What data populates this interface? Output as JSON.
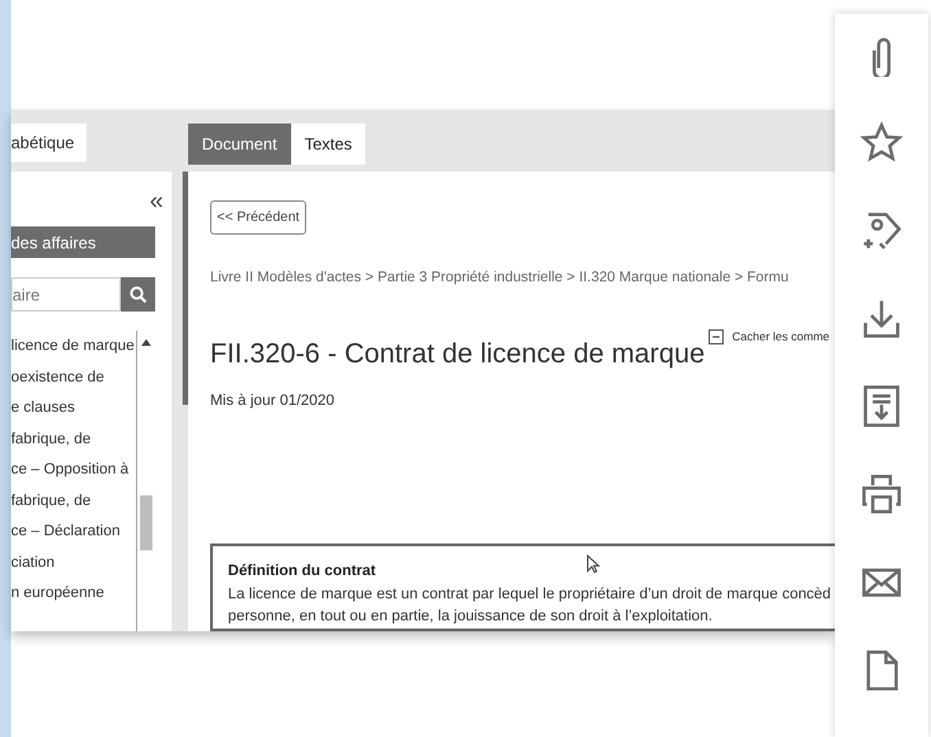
{
  "sidebar": {
    "tab": "abétique",
    "collapse": "«",
    "section": "des affaires",
    "search": {
      "placeholder": "aire"
    },
    "items": [
      "licence de marque",
      "oexistence de",
      "e clauses",
      "fabrique, de",
      "ce – Opposition à",
      "fabrique, de",
      "ce – Déclaration",
      "ciation",
      "n européenne"
    ]
  },
  "tabs": [
    {
      "label": "Document",
      "selected": true
    },
    {
      "label": "Textes",
      "selected": false
    }
  ],
  "document": {
    "back_button": "<< Précédent",
    "breadcrumb": "Livre II Modèles d'actes > Partie 3 Propriété industrielle > II.320 Marque nationale > Formu",
    "toggle_comments": "Cacher les comme",
    "title": "FII.320-6 - Contrat de licence de marque",
    "updated": "Mis à jour 01/2020",
    "definition": {
      "heading": "Définition du contrat",
      "lines": [
        "La licence de marque est un contrat par lequel le propriétaire d’un droit de marque concèd",
        "personne, en tout ou en partie, la jouissance de son droit à l’exploitation."
      ]
    }
  }
}
